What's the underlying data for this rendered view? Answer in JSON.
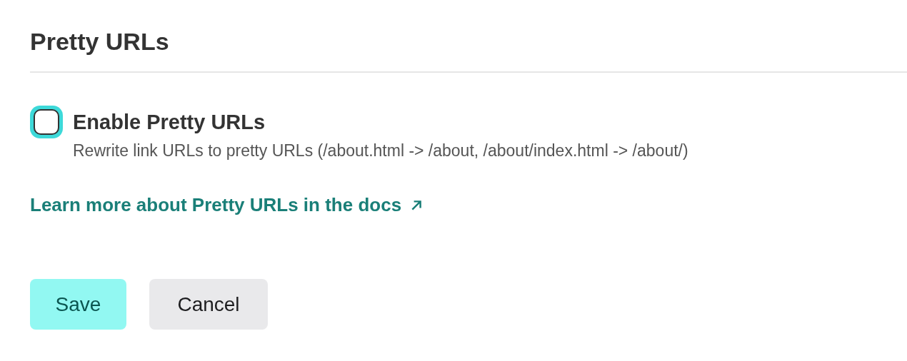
{
  "section": {
    "title": "Pretty URLs"
  },
  "option": {
    "label": "Enable Pretty URLs",
    "checked": false,
    "focused": true,
    "description": "Rewrite link URLs to pretty URLs (/about.html -> /about, /about/index.html -> /about/)"
  },
  "docs_link": {
    "label": "Learn more about Pretty URLs in the docs"
  },
  "buttons": [
    {
      "label": "Save",
      "kind": "primary"
    },
    {
      "label": "Cancel",
      "kind": "secondary"
    }
  ]
}
